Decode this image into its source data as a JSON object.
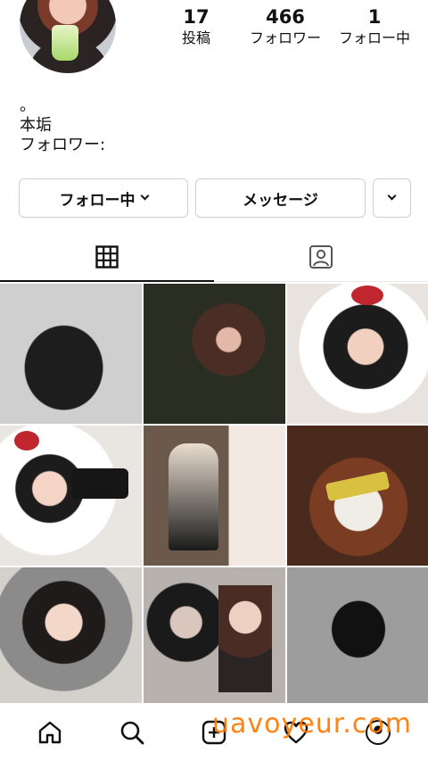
{
  "profile": {
    "stats": [
      {
        "value": "17",
        "label": "投稿"
      },
      {
        "value": "466",
        "label": "フォロワー"
      },
      {
        "value": "1",
        "label": "フォロー中"
      }
    ],
    "bio_lines": [
      "。",
      "本垢",
      "フォロワー:"
    ]
  },
  "actions": {
    "following_label": "フォロー中",
    "message_label": "メッセージ"
  },
  "tabs": {
    "active": "grid",
    "items": [
      "grid-icon",
      "tagged-icon"
    ]
  },
  "grid": {
    "tiles": 9
  },
  "bottom_nav": {
    "items": [
      "home-icon",
      "search-icon",
      "new-post-icon",
      "activity-icon",
      "profile-icon"
    ]
  },
  "watermark": {
    "text": "uavoyeur.com",
    "color": "#ff7a00"
  }
}
